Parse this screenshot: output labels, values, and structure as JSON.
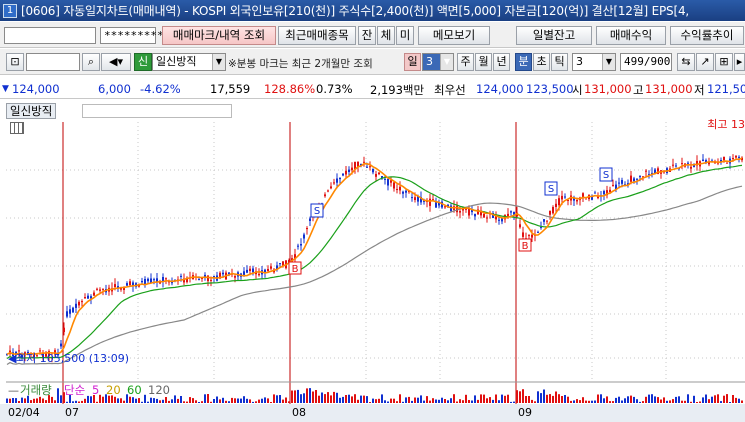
{
  "window": {
    "index": "1",
    "title": "[0606] 자동일지차트(매매내역) - KOSPI 외국인보유[210(천)] 주식수[2,400(천)] 액면[5,000] 자본금[120(억)] 결산[12월] EPS[4,"
  },
  "toolbar1": {
    "code_value": "",
    "password_mask": "*********",
    "buttons": [
      "매매마크/내역 조회",
      "최근매매종목",
      "잔",
      "체",
      "미",
      "메모보기",
      "일별잔고",
      "매매수익",
      "수익률추이"
    ]
  },
  "toolbar2": {
    "search_icon": "search-icon",
    "sound_icon": "speaker-icon",
    "credit_badge": "신",
    "chart_type": "일신방직",
    "note": "※분봉 마크는 최근 2개월만 조회",
    "period_day": "일",
    "period_value": "3",
    "periods": [
      "주",
      "월",
      "년",
      "분",
      "초",
      "틱"
    ],
    "minute_value": "3",
    "count": "499/900"
  },
  "quote": {
    "price": "124,000",
    "change": "6,000",
    "change_pct": "-4.62%",
    "volume": "17,559",
    "vol_ratio": "128.86%",
    "turnover": "0.73%",
    "amount": "2,193백만",
    "best_label": "최우선",
    "best_ask": "124,000",
    "best_bid": "123,500",
    "open_label": "시",
    "open": "131,000",
    "high_label": "고",
    "high": "131,000",
    "low_label": "저",
    "low": "121,50"
  },
  "chart": {
    "tab": "일신방직",
    "high_label": "최고 13",
    "low_label": "최저 105,500 (13:09)",
    "volume_legend": {
      "title": "거래량",
      "simple": "단순",
      "periods": [
        "5",
        "20",
        "60",
        "120"
      ]
    },
    "marks": {
      "buy": "B",
      "sell": "S"
    },
    "x_labels": [
      "02/04",
      "07",
      "08",
      "09"
    ]
  },
  "colors": {
    "price": "#e01010",
    "ma5": "#ff8800",
    "ma20": "#1aa01a",
    "ma60": "#888888",
    "sep": "#c00000",
    "up": "#e01010",
    "down": "#1030d0"
  }
}
